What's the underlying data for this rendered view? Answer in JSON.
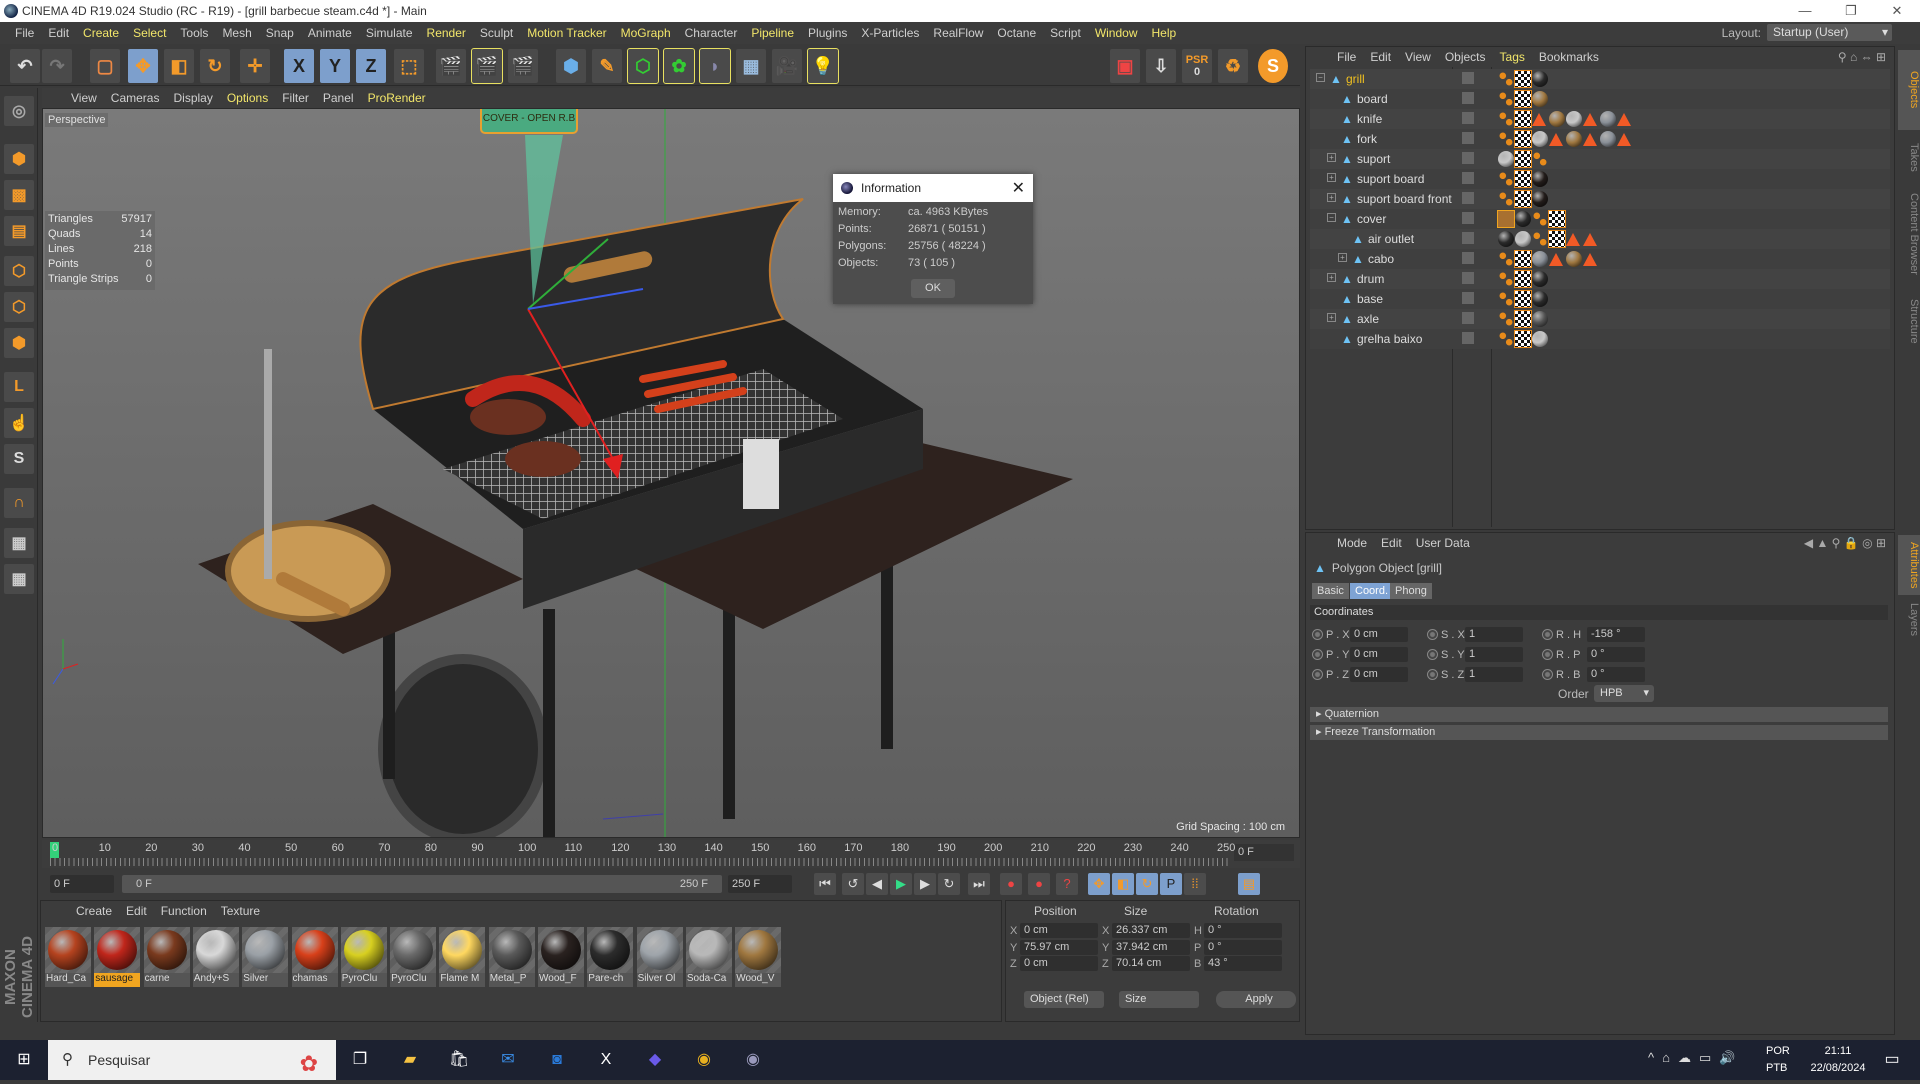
{
  "window": {
    "title": "CINEMA 4D R19.024 Studio (RC - R19) - [grill barbecue steam.c4d *] - Main",
    "minimize": "—",
    "maximize": "❐",
    "close": "✕"
  },
  "menu": [
    "File",
    "Edit",
    "Create",
    "Select",
    "Tools",
    "Mesh",
    "Snap",
    "Animate",
    "Simulate",
    "Render",
    "Sculpt",
    "Motion Tracker",
    "MoGraph",
    "Character",
    "Pipeline",
    "Plugins",
    "X-Particles",
    "RealFlow",
    "Octane",
    "Script",
    "Window",
    "Help"
  ],
  "menu_highlight": [
    "Create",
    "Select",
    "Render",
    "Motion Tracker",
    "MoGraph",
    "Pipeline",
    "Window",
    "Help"
  ],
  "layout": {
    "label": "Layout:",
    "value": "Startup (User)"
  },
  "toolbar": {
    "x_label": "X",
    "y_label": "Y",
    "z_label": "Z",
    "psr_label": "PSR",
    "psr_value": "0"
  },
  "viewport": {
    "menu": [
      "View",
      "Cameras",
      "Display",
      "Options",
      "Filter",
      "Panel",
      "ProRender"
    ],
    "label": "Perspective",
    "stats": [
      {
        "k": "Triangles",
        "v": "57917"
      },
      {
        "k": "Quads",
        "v": "14"
      },
      {
        "k": "Lines",
        "v": "218"
      },
      {
        "k": "Points",
        "v": "0"
      },
      {
        "k": "Triangle Strips",
        "v": "0"
      }
    ],
    "grid_spacing": "Grid Spacing : 100 cm",
    "callout": "COVER - OPEN R.B"
  },
  "info_dialog": {
    "title": "Information",
    "rows": [
      {
        "k": "Memory:",
        "v": "ca. 4963 KBytes"
      },
      {
        "k": "Points:",
        "v": "26871 ( 50151 )"
      },
      {
        "k": "Polygons:",
        "v": "25756 ( 48224 )"
      },
      {
        "k": "Objects:",
        "v": "73 ( 105 )"
      }
    ],
    "ok": "OK",
    "close": "✕"
  },
  "timeline": {
    "ticks": [
      "0",
      "10",
      "20",
      "30",
      "40",
      "50",
      "60",
      "70",
      "80",
      "90",
      "100",
      "110",
      "120",
      "130",
      "140",
      "150",
      "160",
      "170",
      "180",
      "190",
      "200",
      "210",
      "220",
      "230",
      "240",
      "250"
    ],
    "current_frame": "0 F",
    "start_field": "0 F",
    "range_start": "0 F",
    "range_end": "250 F",
    "end_field": "250 F"
  },
  "materials": {
    "menu": [
      "Create",
      "Edit",
      "Function",
      "Texture"
    ],
    "items": [
      {
        "name": "Hard_Ca",
        "color": "#b5431f"
      },
      {
        "name": "sausage",
        "color": "#c0261b",
        "selected": true
      },
      {
        "name": "carne",
        "color": "#7a3a1e"
      },
      {
        "name": "Andy+S",
        "color": "#d8d8d8"
      },
      {
        "name": "Silver",
        "color": "#9aa0a6"
      },
      {
        "name": "chamas",
        "color": "#d8401a"
      },
      {
        "name": "PyroClu",
        "color": "#d8d020"
      },
      {
        "name": "PyroClu",
        "color": "#6a6a6a"
      },
      {
        "name": "Flame M",
        "color": "#ffd860"
      },
      {
        "name": "Metal_P",
        "color": "#5a5a5a"
      },
      {
        "name": "Wood_F",
        "color": "#2a2220"
      },
      {
        "name": "Pare-ch",
        "color": "#2c2c2c"
      },
      {
        "name": "Silver Ol",
        "color": "#9ea4aa"
      },
      {
        "name": "Soda-Ca",
        "color": "#b8b8b8"
      },
      {
        "name": "Wood_V",
        "color": "#a07840"
      }
    ]
  },
  "maxon_logo": "MAXON CINEMA 4D",
  "coord_manager": {
    "headers": [
      "Position",
      "Size",
      "Rotation"
    ],
    "position": [
      {
        "axis": "X",
        "v": "0 cm"
      },
      {
        "axis": "Y",
        "v": "75.97 cm"
      },
      {
        "axis": "Z",
        "v": "0 cm"
      }
    ],
    "size": [
      {
        "axis": "X",
        "v": "26.337 cm"
      },
      {
        "axis": "Y",
        "v": "37.942 cm"
      },
      {
        "axis": "Z",
        "v": "70.14 cm"
      }
    ],
    "rotation": [
      {
        "axis": "H",
        "v": "0 °"
      },
      {
        "axis": "P",
        "v": "0 °"
      },
      {
        "axis": "B",
        "v": "43 °"
      }
    ],
    "mode": "Object (Rel)",
    "size_mode": "Size",
    "apply": "Apply"
  },
  "objects": {
    "menu": [
      "File",
      "Edit",
      "View",
      "Objects",
      "Tags",
      "Bookmarks"
    ],
    "items": [
      {
        "name": "grill",
        "depth": 0,
        "expand": "−",
        "active": true,
        "tags": [
          "dots",
          "chk",
          "ball:#2a2a2a"
        ]
      },
      {
        "name": "board",
        "depth": 1,
        "expand": "",
        "tags": [
          "dots",
          "chk",
          "ball:#a07840"
        ]
      },
      {
        "name": "knife",
        "depth": 1,
        "expand": "",
        "tags": [
          "dots",
          "chk",
          "tri",
          "ball:#a07840",
          "ball:#c8c8c8",
          "tri",
          "ball:#8a9098",
          "tri"
        ]
      },
      {
        "name": "fork",
        "depth": 1,
        "expand": "",
        "tags": [
          "dots",
          "chk",
          "ball:#c8c8c8",
          "tri",
          "ball:#a07840",
          "tri",
          "ball:#8a9098",
          "tri"
        ]
      },
      {
        "name": "suport",
        "depth": 1,
        "expand": "+",
        "tags": [
          "ball:#c8c8c8",
          "chk",
          "dots"
        ]
      },
      {
        "name": "suport board",
        "depth": 1,
        "expand": "+",
        "tags": [
          "dots",
          "chk",
          "ball:#221c1a"
        ]
      },
      {
        "name": "suport board front",
        "depth": 1,
        "expand": "+",
        "tags": [
          "dots",
          "chk",
          "ball:#221c1a"
        ]
      },
      {
        "name": "cover",
        "depth": 1,
        "expand": "−",
        "tags": [
          "sel",
          "ball:#2a2a2a",
          "dots",
          "chk"
        ]
      },
      {
        "name": "air outlet",
        "depth": 2,
        "expand": "",
        "tags": [
          "ball:#2a2a2a",
          "ball:#c8c8c8",
          "dots",
          "chk",
          "tri",
          "tri"
        ]
      },
      {
        "name": "cabo",
        "depth": 2,
        "expand": "+",
        "tags": [
          "dots",
          "chk",
          "ball:#8a9098",
          "tri",
          "ball:#a07840",
          "tri"
        ]
      },
      {
        "name": "drum",
        "depth": 1,
        "expand": "+",
        "tags": [
          "dots",
          "chk",
          "ball:#2a2a2a"
        ]
      },
      {
        "name": "base",
        "depth": 1,
        "expand": "",
        "tags": [
          "dots",
          "chk",
          "ball:#2a2a2a"
        ]
      },
      {
        "name": "axle",
        "depth": 1,
        "expand": "+",
        "tags": [
          "dots",
          "chk",
          "ball:#555555"
        ]
      },
      {
        "name": "grelha baixo",
        "depth": 1,
        "expand": "",
        "tags": [
          "dots",
          "chk",
          "ball:#c8c8c8"
        ]
      }
    ]
  },
  "attributes": {
    "menu": [
      "Mode",
      "Edit",
      "User Data"
    ],
    "object_title": "Polygon Object [grill]",
    "tabs": [
      {
        "label": "Basic"
      },
      {
        "label": "Coord.",
        "active": true
      },
      {
        "label": "Phong"
      }
    ],
    "section": "Coordinates",
    "rows": [
      [
        {
          "l": "P . X",
          "v": "0 cm"
        },
        {
          "l": "S . X",
          "v": "1"
        },
        {
          "l": "R . H",
          "v": "-158 °"
        }
      ],
      [
        {
          "l": "P . Y",
          "v": "0 cm"
        },
        {
          "l": "S . Y",
          "v": "1"
        },
        {
          "l": "R . P",
          "v": "0 °"
        }
      ],
      [
        {
          "l": "P . Z",
          "v": "0 cm"
        },
        {
          "l": "S . Z",
          "v": "1"
        },
        {
          "l": "R . B",
          "v": "0 °"
        }
      ]
    ],
    "order_label": "Order",
    "order_value": "HPB",
    "quaternion": "Quaternion",
    "freeze": "Freeze Transformation"
  },
  "side_tabs": {
    "top": [
      "Objects",
      "Takes",
      "Content Browser",
      "Structure"
    ],
    "bottom": [
      "Attributes",
      "Layers"
    ]
  },
  "taskbar": {
    "search": "Pesquisar",
    "lang1": "POR",
    "lang2": "PTB",
    "time": "21:11",
    "date": "22/08/2024"
  },
  "colors": {
    "accent_yellow": "#f2e66a",
    "active_blue": "#7ea3d4",
    "orange": "#f39a2a",
    "tag_orange": "#f25a26"
  }
}
